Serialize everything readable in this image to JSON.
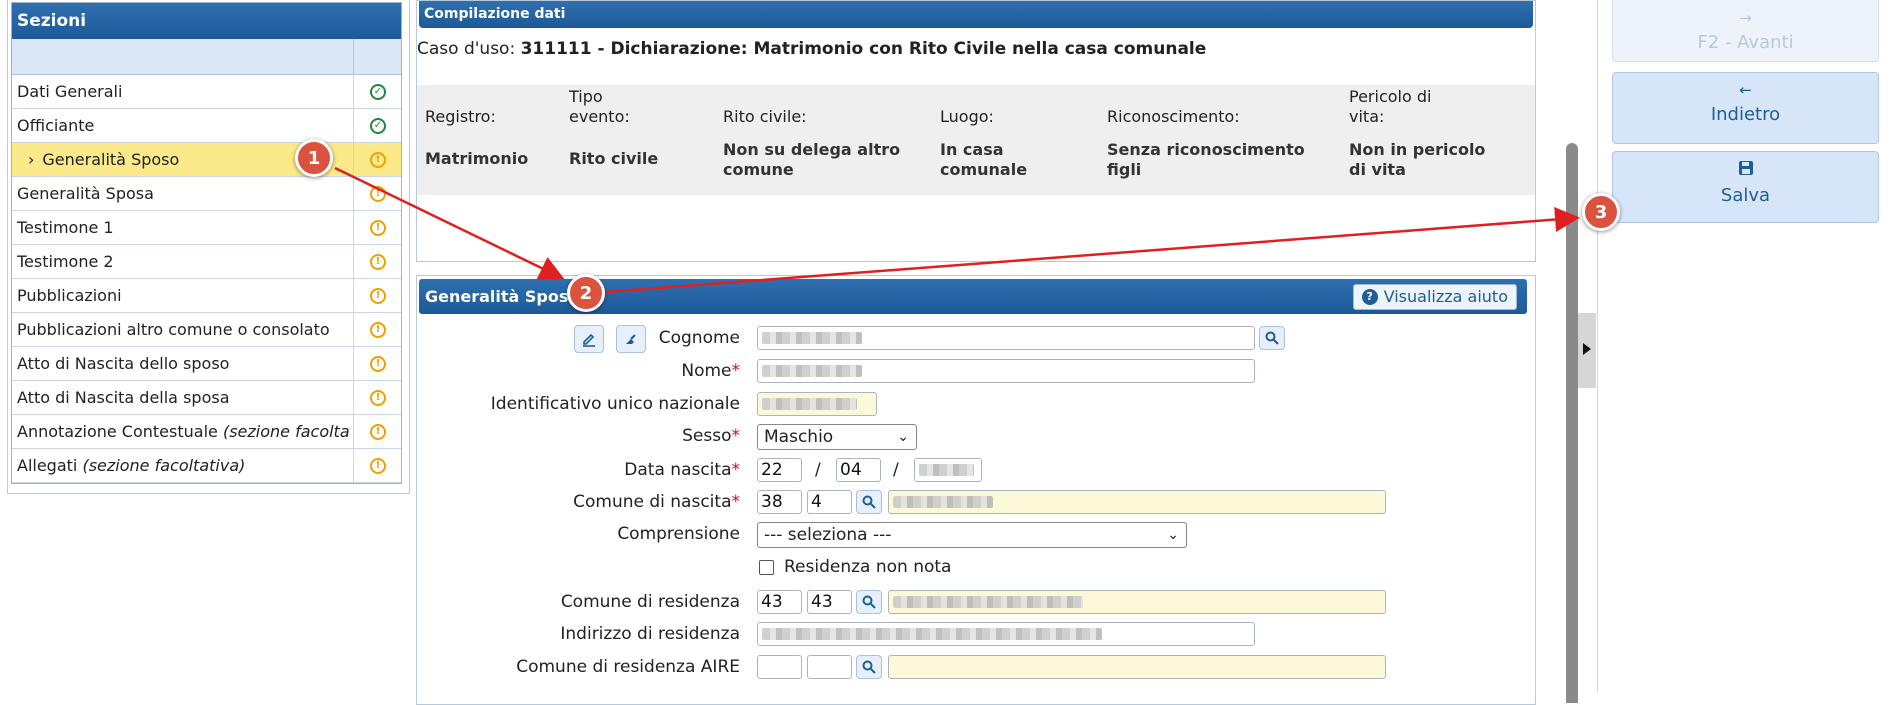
{
  "sections": {
    "title": "Sezioni",
    "items": [
      {
        "label": "Dati Generali",
        "optional": "",
        "status": "ok"
      },
      {
        "label": "Officiante",
        "optional": "",
        "status": "ok"
      },
      {
        "label": "Generalità Sposo",
        "optional": "",
        "status": "warn",
        "active": true
      },
      {
        "label": "Generalità Sposa",
        "optional": "",
        "status": "warn"
      },
      {
        "label": "Testimone 1",
        "optional": "",
        "status": "warn"
      },
      {
        "label": "Testimone 2",
        "optional": "",
        "status": "warn"
      },
      {
        "label": "Pubblicazioni",
        "optional": "",
        "status": "warn"
      },
      {
        "label": "Pubblicazioni altro comune o consolato",
        "optional": "",
        "status": "warn"
      },
      {
        "label": "Atto di Nascita dello sposo",
        "optional": "",
        "status": "warn"
      },
      {
        "label": "Atto di Nascita della sposa",
        "optional": "",
        "status": "warn"
      },
      {
        "label": "Annotazione Contestuale ",
        "optional": "(sezione facoltativa)",
        "status": "warn"
      },
      {
        "label": "Allegati ",
        "optional": "(sezione facoltativa)",
        "status": "warn"
      }
    ],
    "status_ok_symbol": "✓",
    "status_warn_symbol": "!",
    "active_marker": "›"
  },
  "compilation": {
    "title": "Compilazione dati",
    "use_case_label": "Caso d'uso:",
    "use_case_value": "311111 - Dichiarazione: Matrimonio con Rito Civile nella casa comunale",
    "labels": {
      "registro": "Registro:",
      "tipo_evento": "Tipo evento:",
      "rito": "Rito civile:",
      "luogo": "Luogo:",
      "riconoscimento": "Riconoscimento:",
      "pericolo": "Pericolo di vita:"
    },
    "values": {
      "registro": "Matrimonio",
      "tipo_evento": "Rito civile",
      "rito": "Non su delega altro comune",
      "luogo": "In casa comunale",
      "riconoscimento": "Senza riconoscimento figli",
      "pericolo": "Non in pericolo di vita"
    }
  },
  "form": {
    "title": "Generalità Sposo",
    "help_label": "Visualizza aiuto",
    "help_symbol": "?",
    "required_mark": "*",
    "fields": {
      "cognome": "Cognome",
      "nome": "Nome",
      "iun": "Identificativo unico nazionale",
      "sesso": "Sesso",
      "data_nascita": "Data nascita",
      "comune_nascita": "Comune di nascita",
      "comprensione": "Comprensione",
      "residenza_non_nota": "Residenza non nota",
      "comune_residenza": "Comune di residenza",
      "indirizzo_residenza": "Indirizzo di residenza",
      "comune_residenza_aire": "Comune di residenza AIRE"
    },
    "values": {
      "sesso": "Maschio",
      "giorno_nascita": "22",
      "mese_nascita": "04",
      "comune_nascita_cod1": "38",
      "comune_nascita_cod2": "4",
      "comprensione": "--- seleziona ---",
      "comune_residenza_cod1": "43",
      "comune_residenza_cod2": "43",
      "date_separator": "/"
    }
  },
  "actions": {
    "next": {
      "icon": "→",
      "label": "F2 - Avanti"
    },
    "back": {
      "icon": "←",
      "label": "Indietro"
    },
    "save": {
      "icon": "💾",
      "label": "Salva"
    }
  },
  "annotations": [
    "1",
    "2",
    "3"
  ],
  "colors": {
    "header_blue": "#1e5a98",
    "active_row": "#fbe98a",
    "ok_green": "#1e8a3a",
    "warn_orange": "#f0a000",
    "callout_red": "#d9533f",
    "arrow_red": "#e02020"
  }
}
